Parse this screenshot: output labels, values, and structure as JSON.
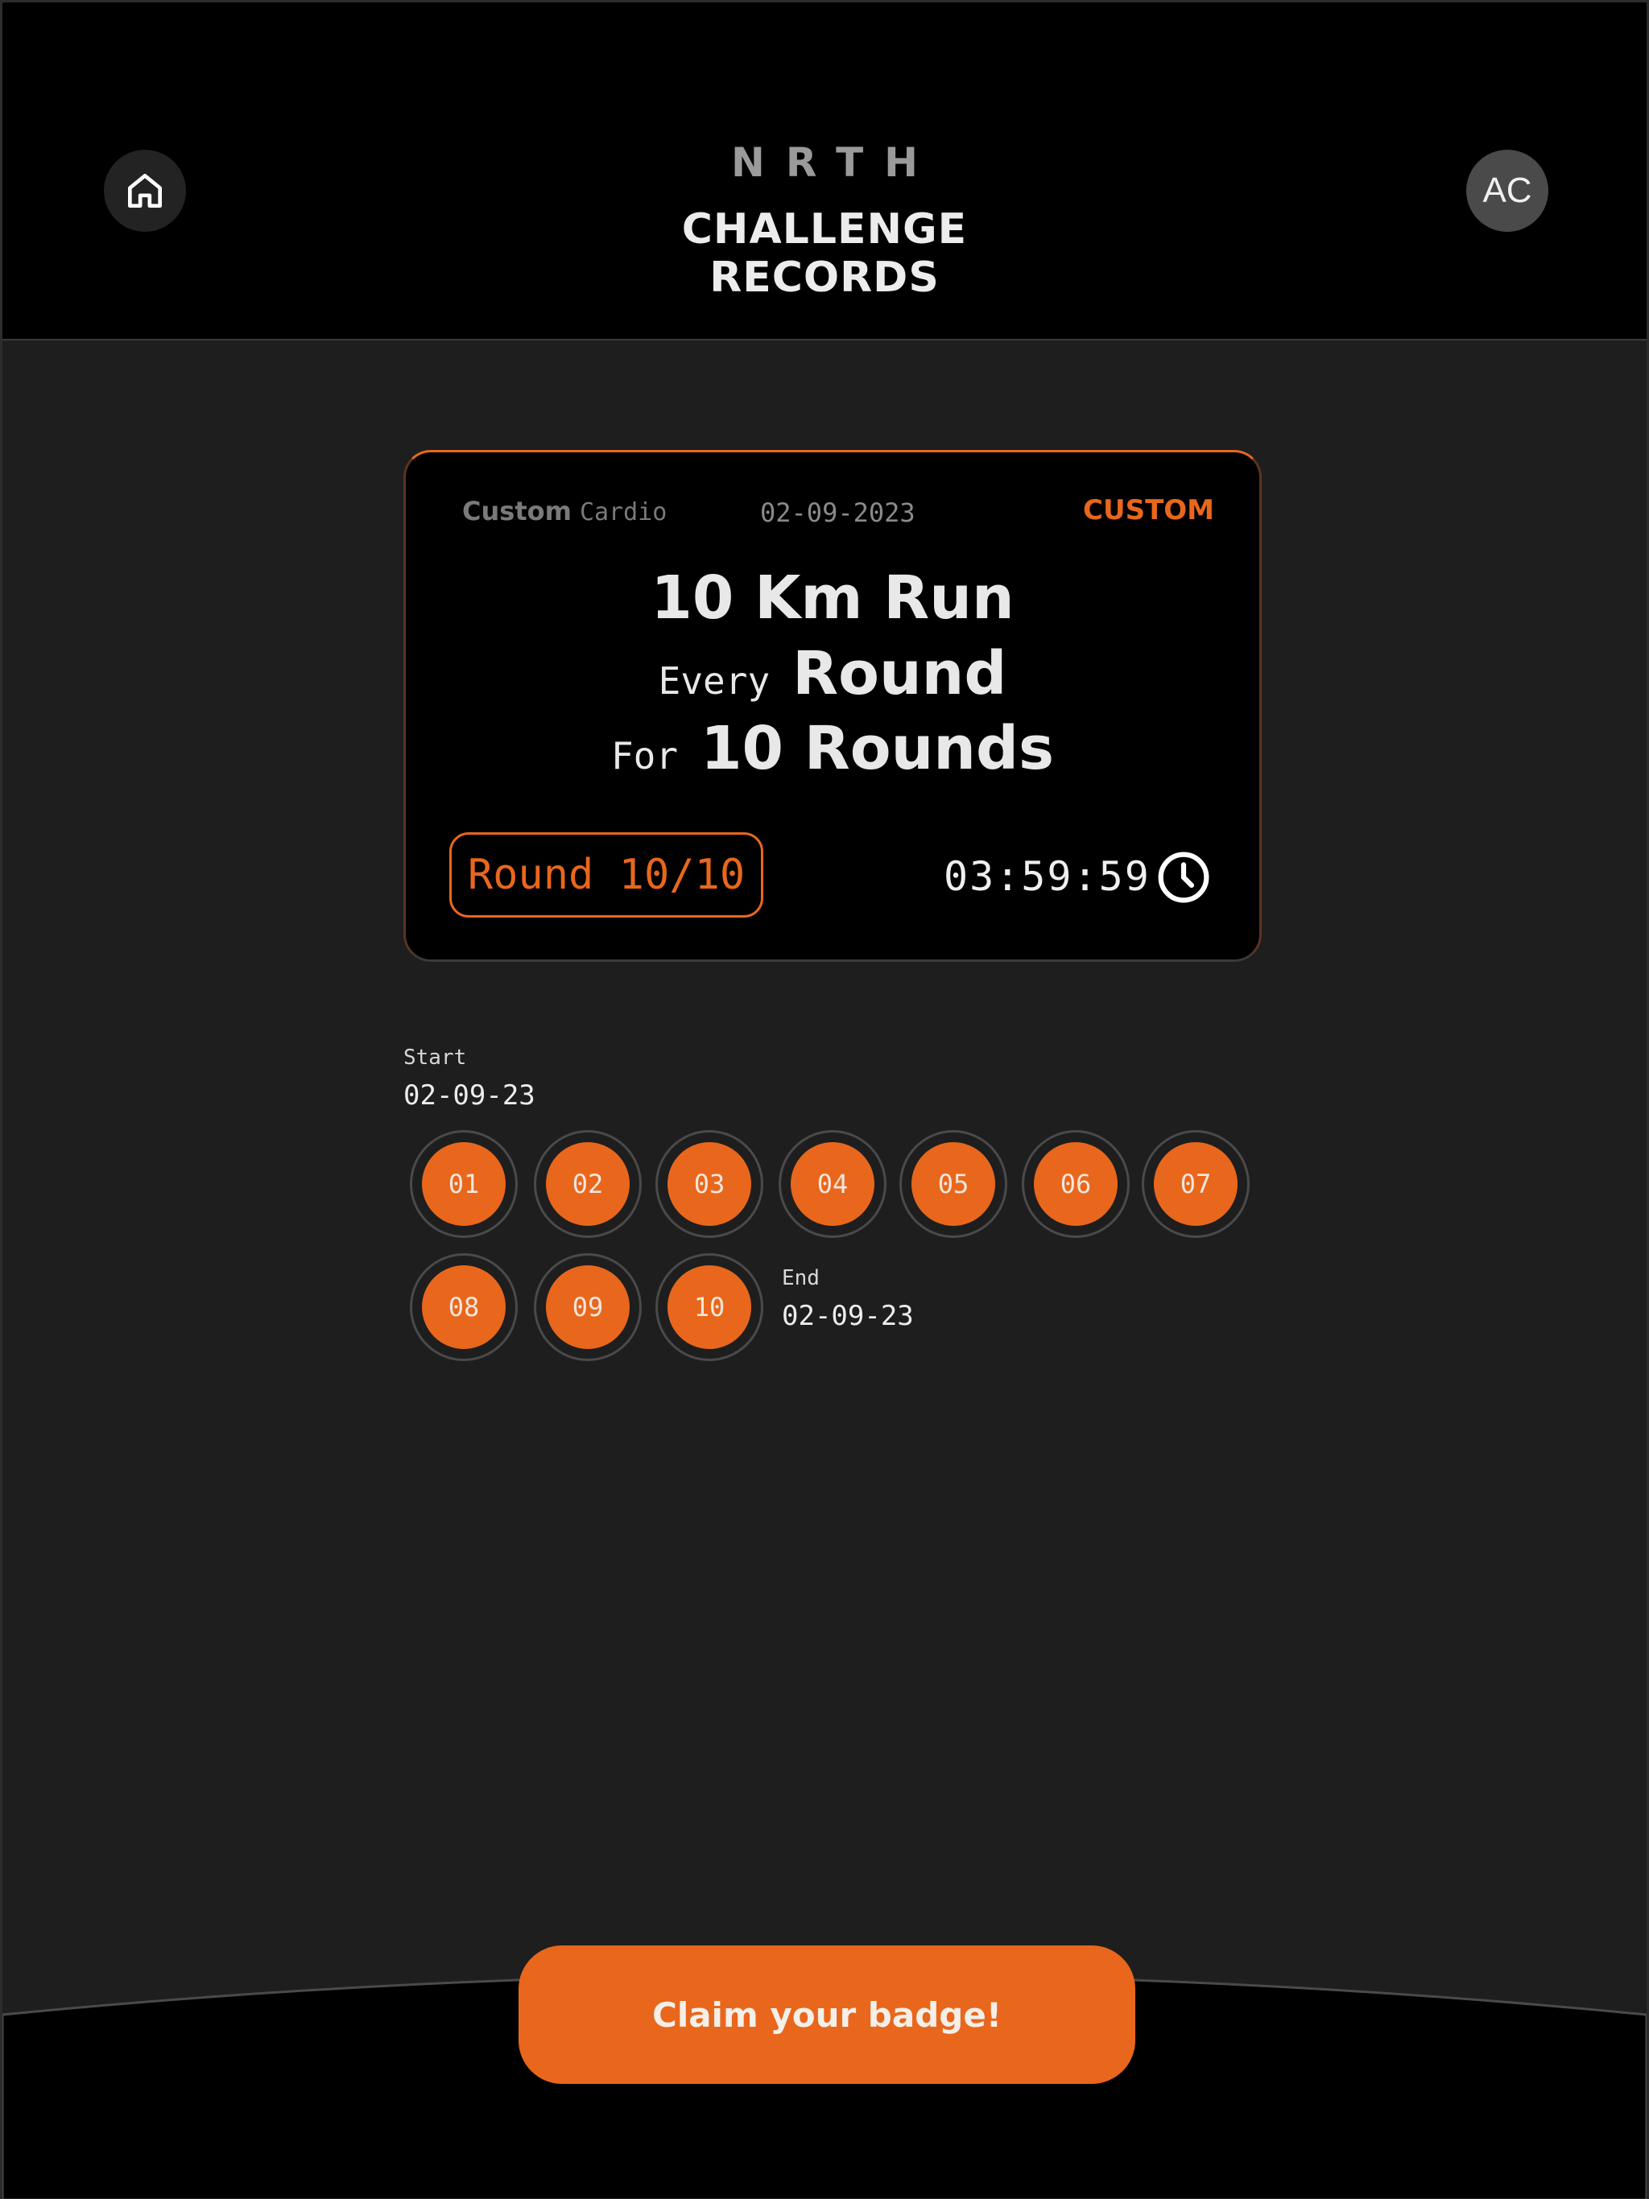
{
  "header": {
    "brand": "NRTH",
    "title_line1": "CHALLENGE",
    "title_line2": "RECORDS",
    "home_icon": "home-icon",
    "avatar_initials": "AC"
  },
  "card": {
    "category_bold": "Custom",
    "category_light": "Cardio",
    "date": "02-09-2023",
    "tag": "CUSTOM",
    "line1": "10 Km Run",
    "line2_small": "Every",
    "line2_big": "Round",
    "line3_small": "For",
    "line3_big": "10 Rounds",
    "round_status": "Round 10/10",
    "timer": "03:59:59",
    "clock_icon": "clock-icon"
  },
  "progress": {
    "start_label": "Start",
    "start_date": "02-09-23",
    "end_label": "End",
    "end_date": "02-09-23",
    "rounds": [
      "01",
      "02",
      "03",
      "04",
      "05",
      "06",
      "07",
      "08",
      "09",
      "10"
    ]
  },
  "footer": {
    "claim_label": "Claim your badge!"
  },
  "colors": {
    "accent": "#e8671c",
    "background": "#1e1e1e",
    "header_bg": "#000000"
  }
}
